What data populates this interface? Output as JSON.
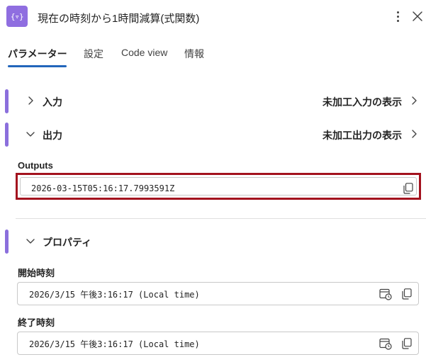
{
  "header": {
    "app_icon_text": "{▿}",
    "title": "現在の時刻から1時間減算(式関数)",
    "more_icon": "more-vertical-icon",
    "close_icon": "close-icon"
  },
  "tabs": [
    {
      "label": "パラメーター",
      "active": true
    },
    {
      "label": "設定",
      "active": false
    },
    {
      "label": "Code view",
      "active": false
    },
    {
      "label": "情報",
      "active": false
    }
  ],
  "sections": {
    "input": {
      "label": "入力",
      "raw_link": "未加工入力の表示",
      "expanded": false
    },
    "output": {
      "label": "出力",
      "raw_link": "未加工出力の表示",
      "expanded": true
    },
    "properties": {
      "label": "プロパティ",
      "expanded": true
    }
  },
  "outputs": {
    "label": "Outputs",
    "value": "2026-03-15T05:16:17.7993591Z"
  },
  "properties": {
    "start_time": {
      "label": "開始時刻",
      "value": "2026/3/15 午後3:16:17 (Local time)"
    },
    "end_time": {
      "label": "終了時刻",
      "value": "2026/3/15 午後3:16:17 (Local time)"
    }
  },
  "colors": {
    "accent": "#8b6fdc",
    "tab_underline": "#2266bb",
    "highlight_border": "#a3121e"
  }
}
